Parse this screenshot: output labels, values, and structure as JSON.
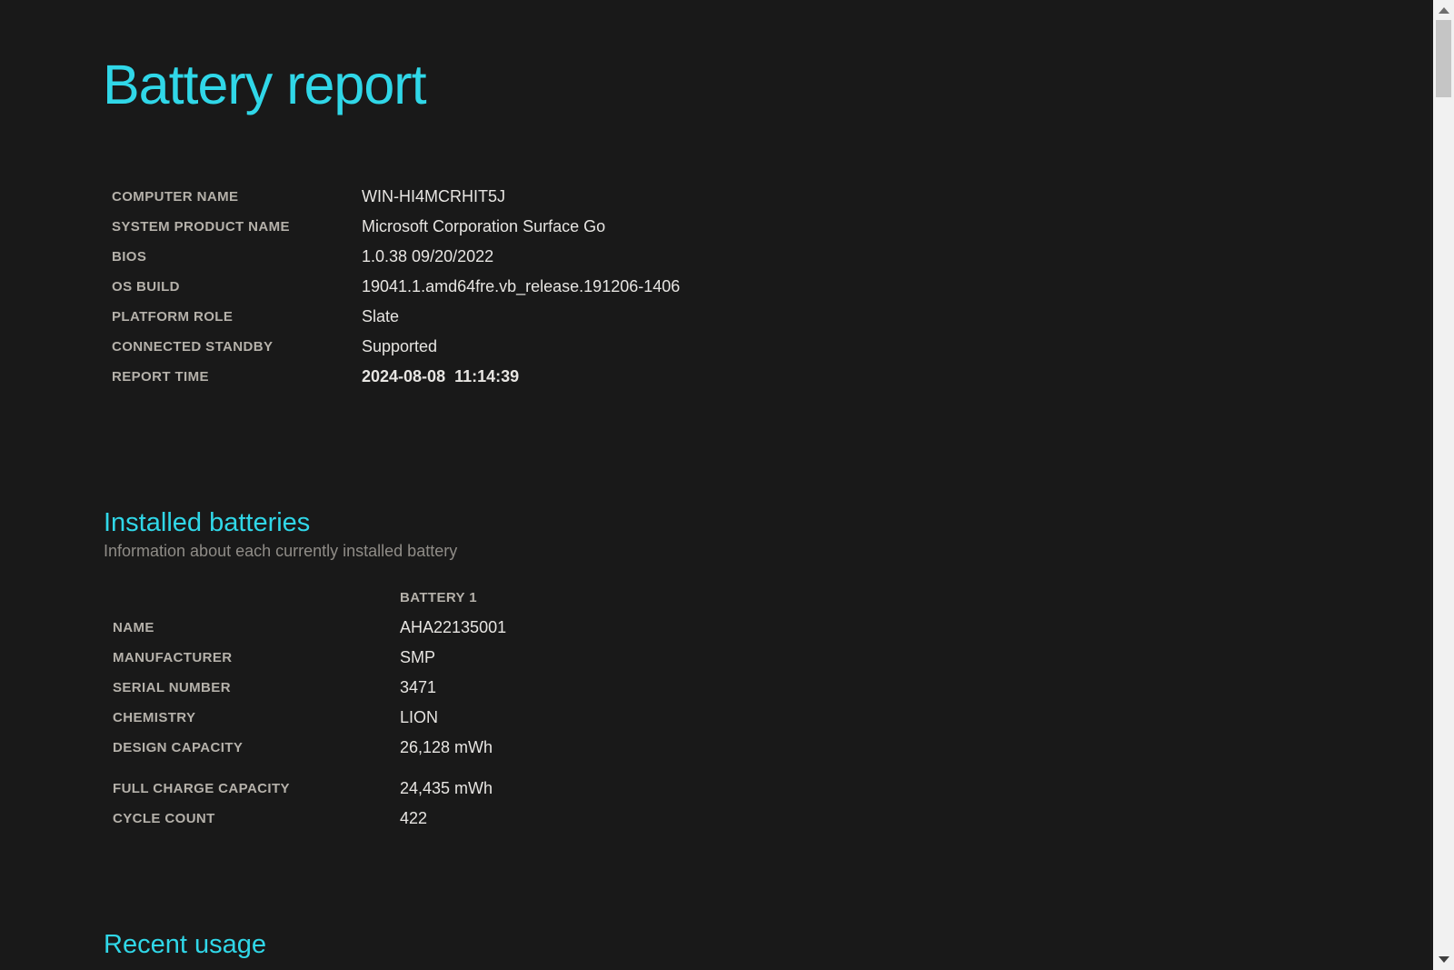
{
  "title": "Battery report",
  "system_info": {
    "rows": [
      {
        "label": "COMPUTER NAME",
        "value": "WIN-HI4MCRHIT5J"
      },
      {
        "label": "SYSTEM PRODUCT NAME",
        "value": "Microsoft Corporation Surface Go"
      },
      {
        "label": "BIOS",
        "value": "1.0.38 09/20/2022"
      },
      {
        "label": "OS BUILD",
        "value": "19041.1.amd64fre.vb_release.191206-1406"
      },
      {
        "label": "PLATFORM ROLE",
        "value": "Slate"
      },
      {
        "label": "CONNECTED STANDBY",
        "value": "Supported"
      },
      {
        "label": "REPORT TIME",
        "value": "2024-08-08  11:14:39"
      }
    ]
  },
  "installed_batteries": {
    "heading": "Installed batteries",
    "subtitle": "Information about each currently installed battery",
    "column_header": "BATTERY 1",
    "rows": [
      {
        "label": "NAME",
        "value": "AHA22135001"
      },
      {
        "label": "MANUFACTURER",
        "value": "SMP"
      },
      {
        "label": "SERIAL NUMBER",
        "value": "3471"
      },
      {
        "label": "CHEMISTRY",
        "value": "LION"
      },
      {
        "label": "DESIGN CAPACITY",
        "value": "26,128 mWh"
      },
      {
        "label": "FULL CHARGE CAPACITY",
        "value": "24,435 mWh"
      },
      {
        "label": "CYCLE COUNT",
        "value": "422"
      }
    ]
  },
  "recent_usage": {
    "heading": "Recent usage"
  },
  "colors": {
    "accent": "#30D7E8",
    "background": "#191919",
    "label_text": "#B5B1AA",
    "value_text": "#E7E5E2",
    "subtitle_text": "#8F8C87",
    "scrollbar_track": "#F1F1F1",
    "scrollbar_thumb": "#C5C5C5"
  }
}
